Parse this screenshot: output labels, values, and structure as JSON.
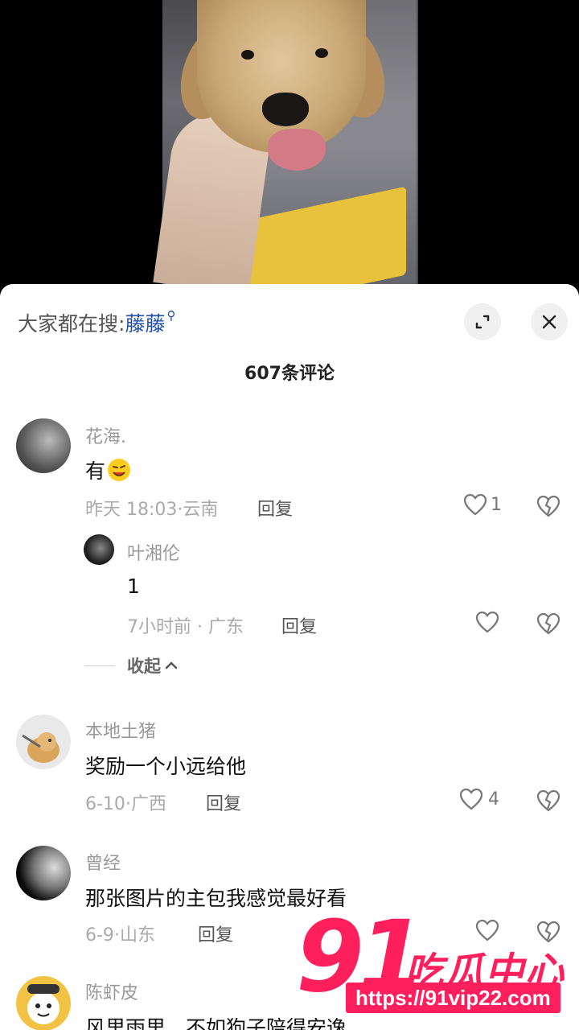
{
  "search": {
    "prefix": "大家都在搜:",
    "term": "藤藤"
  },
  "comment_count_label": "607条评论",
  "comments": [
    {
      "name": "花海.",
      "text": "有",
      "time": "昨天 18:03",
      "region": "云南",
      "reply_label": "回复",
      "likes": "1"
    },
    {
      "name": "本地土猪",
      "text": "奖励一个小远给他",
      "time": "6-10",
      "region": "广西",
      "reply_label": "回复",
      "likes": "4"
    },
    {
      "name": "曾经",
      "text": "那张图片的主包我感觉最好看",
      "time": "6-9",
      "region": "山东",
      "reply_label": "回复",
      "likes": ""
    },
    {
      "name": "陈虾皮",
      "text": "风里雨里，不如狗子陪得安逸"
    }
  ],
  "reply": {
    "name": "叶湘伦",
    "text": "1",
    "time": "7小时前",
    "region": "广东",
    "reply_label": "回复"
  },
  "collapse_label": "收起",
  "watermark": {
    "number": "91",
    "brand": "吃瓜中心",
    "url": "https://91vip22.com"
  },
  "colors": {
    "accent_link": "#1f4ea8",
    "watermark": "#ff1f5c"
  }
}
